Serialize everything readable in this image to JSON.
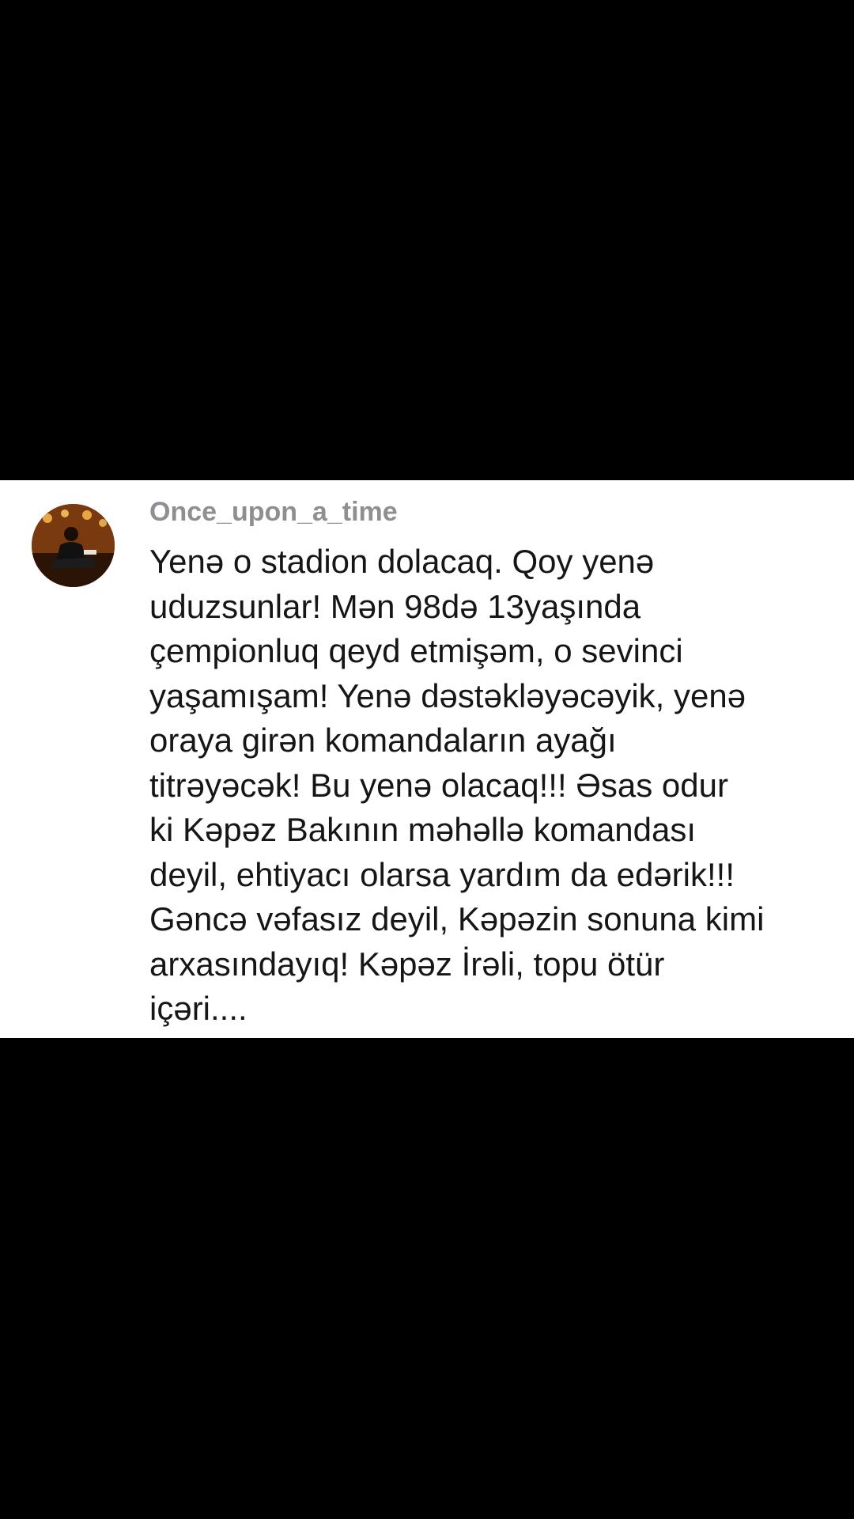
{
  "comment": {
    "username": "Once_upon_a_time",
    "avatar_icon": "user-avatar-photo",
    "lines": [
      "Yenə o stadion dolacaq. Qoy yenə",
      "uduzsunlar! Mən 98də 13yaşında",
      "çempionluq qeyd etmişəm, o sevinci",
      "yaşamışam! Yenə dəstəkləyəcəyik, yenə",
      "oraya girən komandaların ayağı",
      "titrəyəcək! Bu yenə olacaq!!! Əsas odur",
      "ki Kəpəz Bakının məhəllə komandası",
      "deyil, ehtiyacı olarsa yardım da edərik!!!",
      "Gəncə vəfasız deyil, Kəpəzin sonuna kimi",
      "arxasındayıq! Kəpəz İrəli, topu ötür",
      "içəri...."
    ]
  },
  "colors": {
    "background": "#000000",
    "card": "#ffffff",
    "username": "#8e8e93",
    "text": "#161616"
  }
}
